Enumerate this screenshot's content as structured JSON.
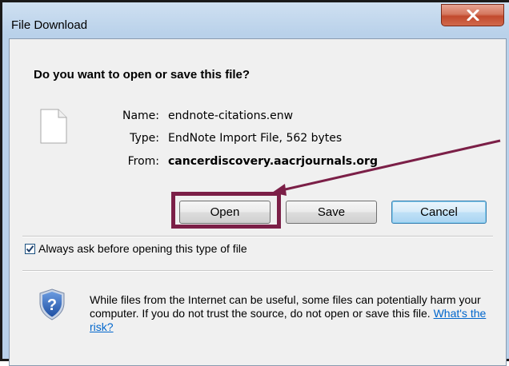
{
  "window": {
    "title": "File Download"
  },
  "dialog": {
    "question": "Do you want to open or save this file?",
    "file": {
      "name_label": "Name:",
      "name_value": "endnote-citations.enw",
      "type_label": "Type:",
      "type_value": "EndNote Import File, 562 bytes",
      "from_label": "From:",
      "from_value": "cancerdiscovery.aacrjournals.org"
    },
    "buttons": {
      "open": "Open",
      "save": "Save",
      "cancel": "Cancel"
    },
    "checkbox": {
      "label": "Always ask before opening this type of file",
      "checked": true
    },
    "warning": {
      "text": "While files from the Internet can be useful, some files can potentially harm your computer. If you do not trust the source, do not open or save this file.",
      "link": "What's the risk?"
    }
  },
  "annotation": {
    "color": "#7b1f47"
  }
}
